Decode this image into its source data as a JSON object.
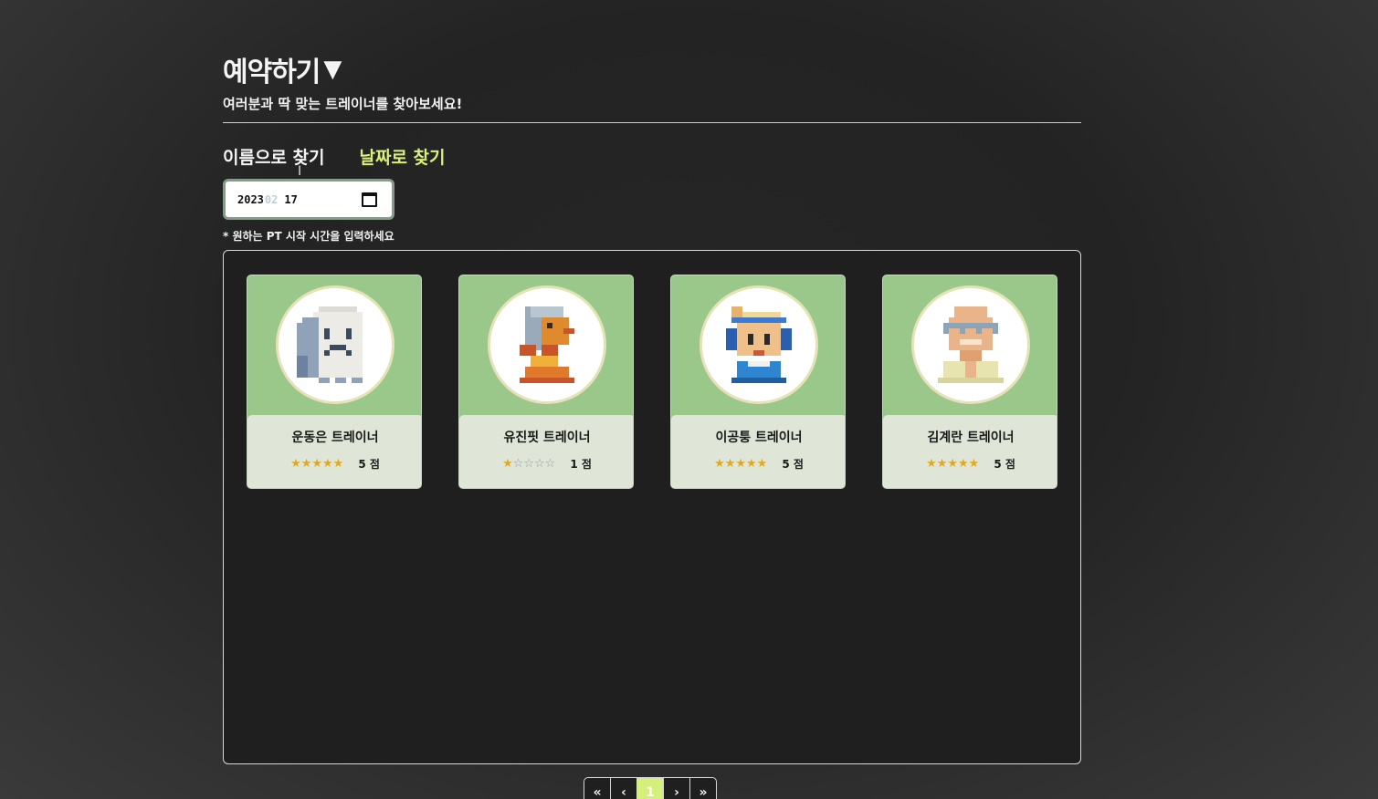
{
  "header": {
    "title": "예약하기",
    "title_arrow": "▼",
    "subtitle": "여러분과 딱 맞는 트레이너를 찾아보세요!"
  },
  "tabs": [
    {
      "label": "이름으로 찾기"
    },
    {
      "label": "날짜로 찾기"
    }
  ],
  "date_input": {
    "year": "2023",
    "month": "02",
    "day": "17"
  },
  "hint": "* 원하는 PT 시작 시간을 입력하세요",
  "trainers": [
    {
      "name": "운동은 트레이너",
      "stars_on": "★★★★★",
      "stars_off": "",
      "score": "5 점",
      "rating": 5,
      "avatar": "ghost-avatar"
    },
    {
      "name": "유진핏 트레이너",
      "stars_on": "★",
      "stars_off": "☆☆☆☆",
      "score": "1 점",
      "rating": 1,
      "avatar": "ponytail-avatar"
    },
    {
      "name": "이공퉁 트레이너",
      "stars_on": "★★★★★",
      "stars_off": "",
      "score": "5 점",
      "rating": 5,
      "avatar": "headset-avatar"
    },
    {
      "name": "김계란 트레이너",
      "stars_on": "★★★★★",
      "stars_off": "",
      "score": "5 점",
      "rating": 5,
      "avatar": "glasses-avatar"
    }
  ],
  "pagination": {
    "first": "«",
    "prev": "‹",
    "current": "1",
    "next": "›",
    "last": "»"
  },
  "colors": {
    "accent": "#d5f07a",
    "card_bg": "#9ac78a",
    "card_info_bg": "#dfe6d8",
    "star": "#e3a81f"
  }
}
